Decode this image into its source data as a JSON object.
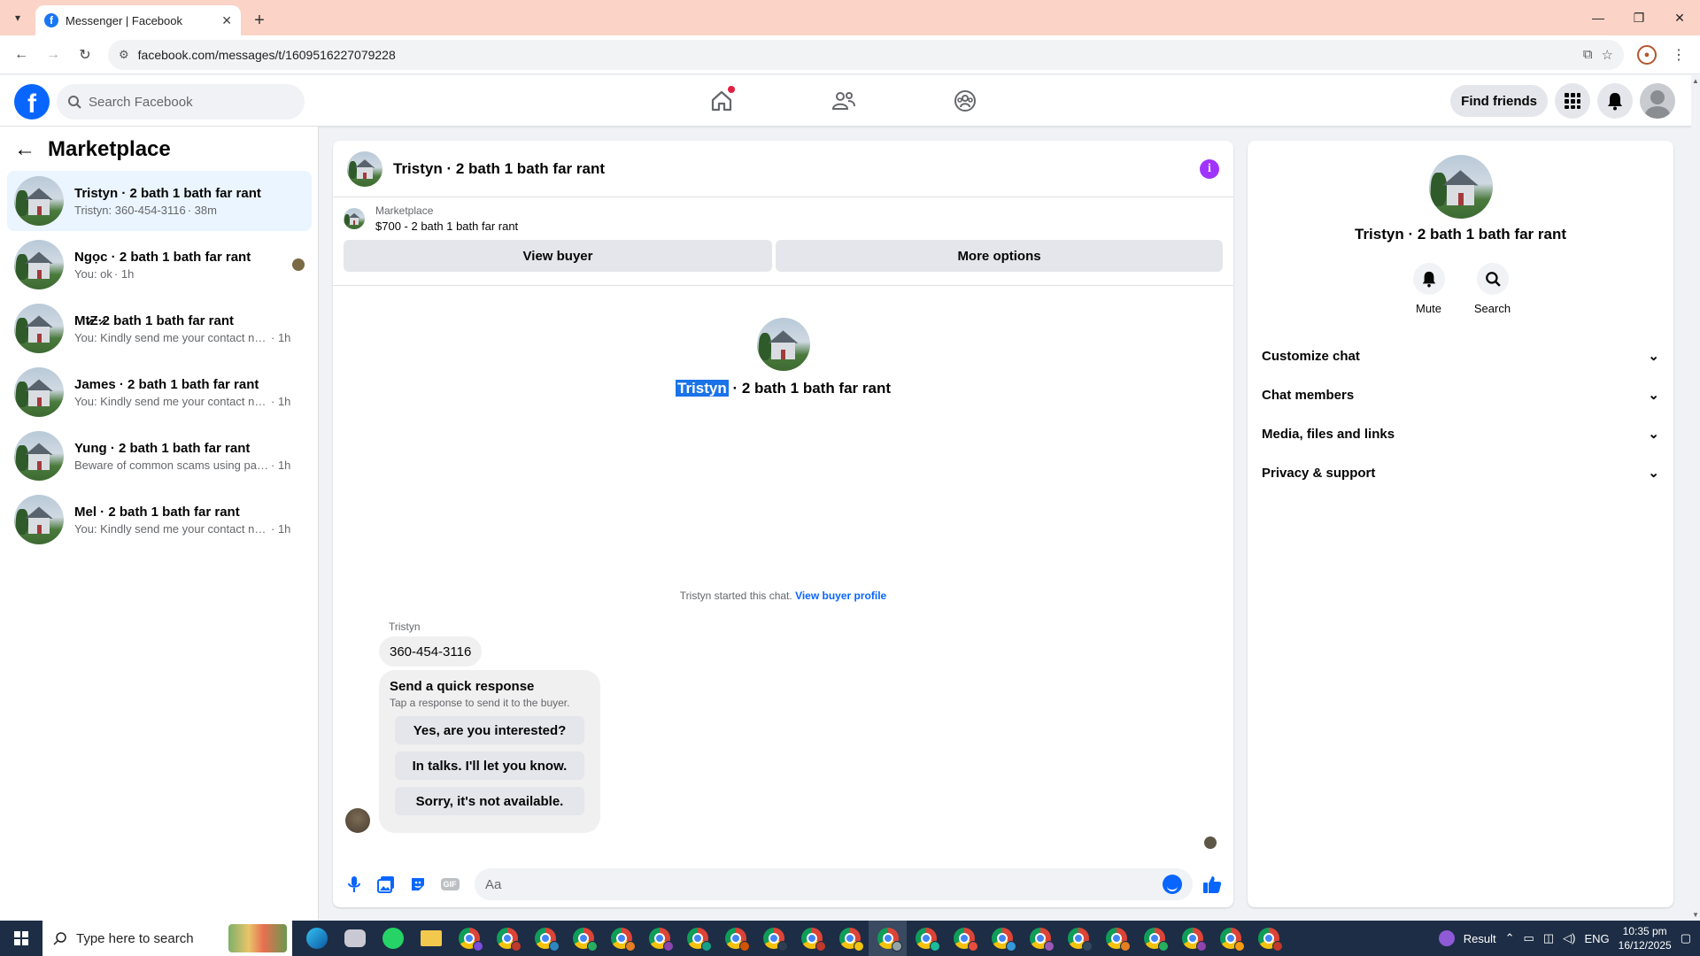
{
  "browser": {
    "tab_title": "Messenger | Facebook",
    "url": "facebook.com/messages/t/1609516227079228"
  },
  "fb_header": {
    "search_placeholder": "Search Facebook",
    "find_friends": "Find friends"
  },
  "sidebar": {
    "title": "Marketplace",
    "conversations": [
      {
        "name": "Tristyn · 2 bath 1 bath far rant",
        "preview": "Tristyn: 360-454-3116",
        "time": "· 38m",
        "active": true
      },
      {
        "name": "Ngọc · 2 bath 1 bath far rant",
        "preview": "You: ok",
        "time": "· 1h",
        "active": false
      },
      {
        "name": "Mt̷Ƶ·̷2 bath 1 bath far rant",
        "preview": "You: Kindly send me your contact nu...",
        "time": "· 1h",
        "active": false
      },
      {
        "name": "James · 2 bath 1 bath far rant",
        "preview": "You: Kindly send me your contact nu...",
        "time": "· 1h",
        "active": false
      },
      {
        "name": "Yung · 2 bath 1 bath far rant",
        "preview": "Beware of common scams using pay...",
        "time": "· 1h",
        "active": false
      },
      {
        "name": "Mel · 2 bath 1 bath far rant",
        "preview": "You: Kindly send me your contact nu...",
        "time": "· 1h",
        "active": false
      }
    ]
  },
  "chat": {
    "header_title": "Tristyn · 2 bath 1 bath far rant",
    "marketplace_label": "Marketplace",
    "listing": "$700 - 2 bath 1 bath far rant",
    "view_buyer": "View buyer",
    "more_options": "More options",
    "center_name_highlight": "Tristyn",
    "center_name_rest": " · 2 bath 1 bath far rant",
    "started_text": "Tristyn started this chat.",
    "view_buyer_profile": "View buyer profile",
    "sender": "Tristyn",
    "message": "360-454-3116",
    "quick_title": "Send a quick response",
    "quick_sub": "Tap a response to send it to the buyer.",
    "quick_options": [
      "Yes, are you interested?",
      "In talks. I'll let you know.",
      "Sorry, it's not available."
    ],
    "composer_placeholder": "Aa"
  },
  "right_panel": {
    "name": "Tristyn · 2 bath 1 bath far rant",
    "mute": "Mute",
    "search": "Search",
    "sections": [
      "Customize chat",
      "Chat members",
      "Media, files and links",
      "Privacy & support"
    ]
  },
  "taskbar": {
    "search_placeholder": "Type here to search",
    "result_label": "Result",
    "lang": "ENG",
    "time": "10:35 pm",
    "date": "16/12/2025"
  },
  "colors": {
    "fb_blue": "#0866ff",
    "info_purple": "#a033ff",
    "active_conv_bg": "#ebf5ff",
    "tab_strip": "#fbd3c7"
  }
}
